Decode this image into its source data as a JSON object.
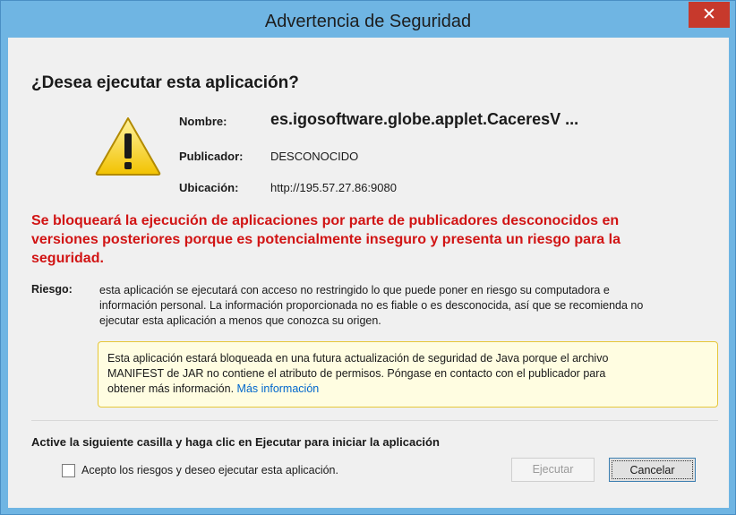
{
  "window": {
    "title": "Advertencia de Seguridad",
    "close_symbol": "✕"
  },
  "dialog": {
    "heading": "¿Desea ejecutar esta aplicación?",
    "icon": "warning-triangle-icon",
    "info": {
      "name_label": "Nombre:",
      "name_value": "es.igosoftware.globe.applet.CaceresV ...",
      "publisher_label": "Publicador:",
      "publisher_value": "DESCONOCIDO",
      "location_label": "Ubicación:",
      "location_value": "http://195.57.27.86:9080"
    },
    "red_warning_lines": [
      "Se bloqueará la ejecución de aplicaciones por parte de publicadores desconocidos en",
      "versiones posteriores porque es potencialmente inseguro y presenta un riesgo para la",
      "seguridad."
    ],
    "risk_label": "Riesgo:",
    "risk_lines": [
      "esta aplicación se ejecutará con acceso no restringido lo que puede poner en riesgo su computadora e",
      "información personal. La información proporcionada no es fiable o es desconocida, así que se recomienda no",
      "ejecutar esta aplicación a menos que conozca su origen."
    ],
    "notice_lines": [
      "Esta aplicación estará bloqueada en una futura actualización de seguridad de Java porque el archivo",
      "MANIFEST de JAR no contiene el atributo de permisos. Póngase en contacto con el publicador para",
      "obtener más información."
    ],
    "notice_link": "Más información",
    "activate_label": "Active la siguiente casilla y haga clic en Ejecutar para iniciar la aplicación",
    "checkbox_label": "Acepto los riesgos y deseo ejecutar esta aplicación.",
    "checkbox_checked": false,
    "run_button": "Ejecutar",
    "cancel_button": "Cancelar"
  },
  "colors": {
    "title_bar": "#6fb5e3",
    "close_button": "#c7392c",
    "warning_text": "#d11414",
    "notice_background": "#fffde1",
    "notice_border": "#e6c73a",
    "link": "#0066cc"
  }
}
